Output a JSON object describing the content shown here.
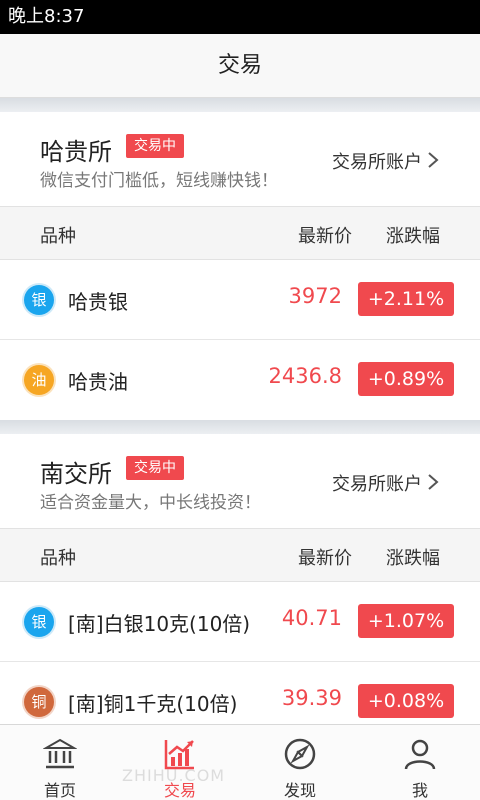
{
  "status_bar": {
    "time": "晚上8:37"
  },
  "title": "交易",
  "exchanges": [
    {
      "name": "哈贵所",
      "badge": "交易中",
      "slogan": "微信支付门槛低，短线赚快钱！",
      "account_link": "交易所账户",
      "headers": {
        "name": "品种",
        "price": "最新价",
        "change": "涨跌幅"
      },
      "rows": [
        {
          "icon_char": "银",
          "name": "哈贵银",
          "price": "3972",
          "change": "+2.11%"
        },
        {
          "icon_char": "油",
          "name": "哈贵油",
          "price": "2436.8",
          "change": "+0.89%"
        }
      ]
    },
    {
      "name": "南交所",
      "badge": "交易中",
      "slogan": "适合资金量大，中长线投资！",
      "account_link": "交易所账户",
      "headers": {
        "name": "品种",
        "price": "最新价",
        "change": "涨跌幅"
      },
      "rows": [
        {
          "icon_char": "银",
          "name": "[南]白银10克(10倍)",
          "price": "40.71",
          "change": "+1.07%"
        },
        {
          "icon_char": "铜",
          "name": "[南]铜1千克(10倍)",
          "price": "39.39",
          "change": "+0.08%"
        }
      ]
    }
  ],
  "tabs": [
    {
      "label": "首页",
      "icon": "bank-icon"
    },
    {
      "label": "交易",
      "icon": "chart-icon",
      "active": true
    },
    {
      "label": "发现",
      "icon": "compass-icon"
    },
    {
      "label": "我",
      "icon": "person-icon"
    }
  ],
  "watermark": "ZHIHU.COM",
  "colors": {
    "accent": "#f0494e",
    "silver": "#1aa5ee",
    "oil": "#f6a623",
    "copper": "#d0683c"
  }
}
